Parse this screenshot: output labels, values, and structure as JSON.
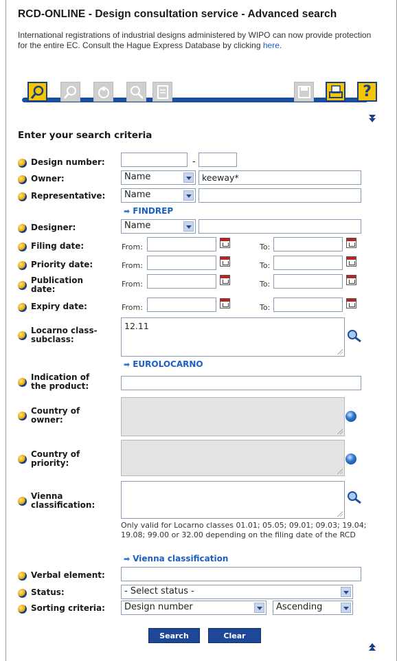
{
  "page_title": "RCD-ONLINE - Design consultation service - Advanced search",
  "intro": {
    "text": "International registrations of industrial designs administered by WIPO can now provide protection for the entire EC. Consult the Hague Express Database by clicking",
    "link": "here."
  },
  "toolbar": {
    "left_icons": [
      "search-icon",
      "advanced-search-icon",
      "results-icon",
      "zoom-icon",
      "document-icon"
    ],
    "right_icons": [
      "save-icon",
      "print-icon",
      "help-icon"
    ],
    "help_glyph": "?",
    "active_color": "#f4c600",
    "bar_color": "#1a4ea0"
  },
  "section_title": "Enter your search criteria",
  "fields": {
    "design_number": {
      "label": "Design number:",
      "dash": "-"
    },
    "owner": {
      "label": "Owner:",
      "type": "Name",
      "value": "keeway*"
    },
    "representative": {
      "label": "Representative:",
      "type": "Name",
      "value": "",
      "link": "FINDREP"
    },
    "designer": {
      "label": "Designer:",
      "type": "Name",
      "value": ""
    },
    "filing_date": {
      "label": "Filing date:",
      "from": "From:",
      "to": "To:"
    },
    "priority_date": {
      "label": "Priority date:",
      "from": "From:",
      "to": "To:"
    },
    "publication_date": {
      "label_1": "Publication",
      "label_2": "date:",
      "from": "From:",
      "to": "To:"
    },
    "expiry_date": {
      "label": "Expiry date:",
      "from": "From:",
      "to": "To:"
    },
    "locarno": {
      "label_1": "Locarno class-",
      "label_2": "subclass:",
      "value": "12.11",
      "link": "EUROLOCARNO"
    },
    "indication": {
      "label_1": "Indication of",
      "label_2": "the product:"
    },
    "country_owner": {
      "label_1": "Country of",
      "label_2": "owner:"
    },
    "country_priority": {
      "label_1": "Country of",
      "label_2": "priority:"
    },
    "vienna": {
      "label_1": "Vienna",
      "label_2": "classification:",
      "note": "Only valid for Locarno classes 01.01; 05.05; 09.01; 09.03; 19.04; 19.08; 99.00 or 32.00 depending on the filing date of the RCD",
      "link": "Vienna classification"
    },
    "verbal": {
      "label": "Verbal element:"
    },
    "status": {
      "label": "Status:",
      "value": "- Select status -"
    },
    "sorting": {
      "label": "Sorting criteria:",
      "value": "Design number",
      "order": "Ascending"
    }
  },
  "buttons": {
    "search": "Search",
    "clear": "Clear"
  }
}
